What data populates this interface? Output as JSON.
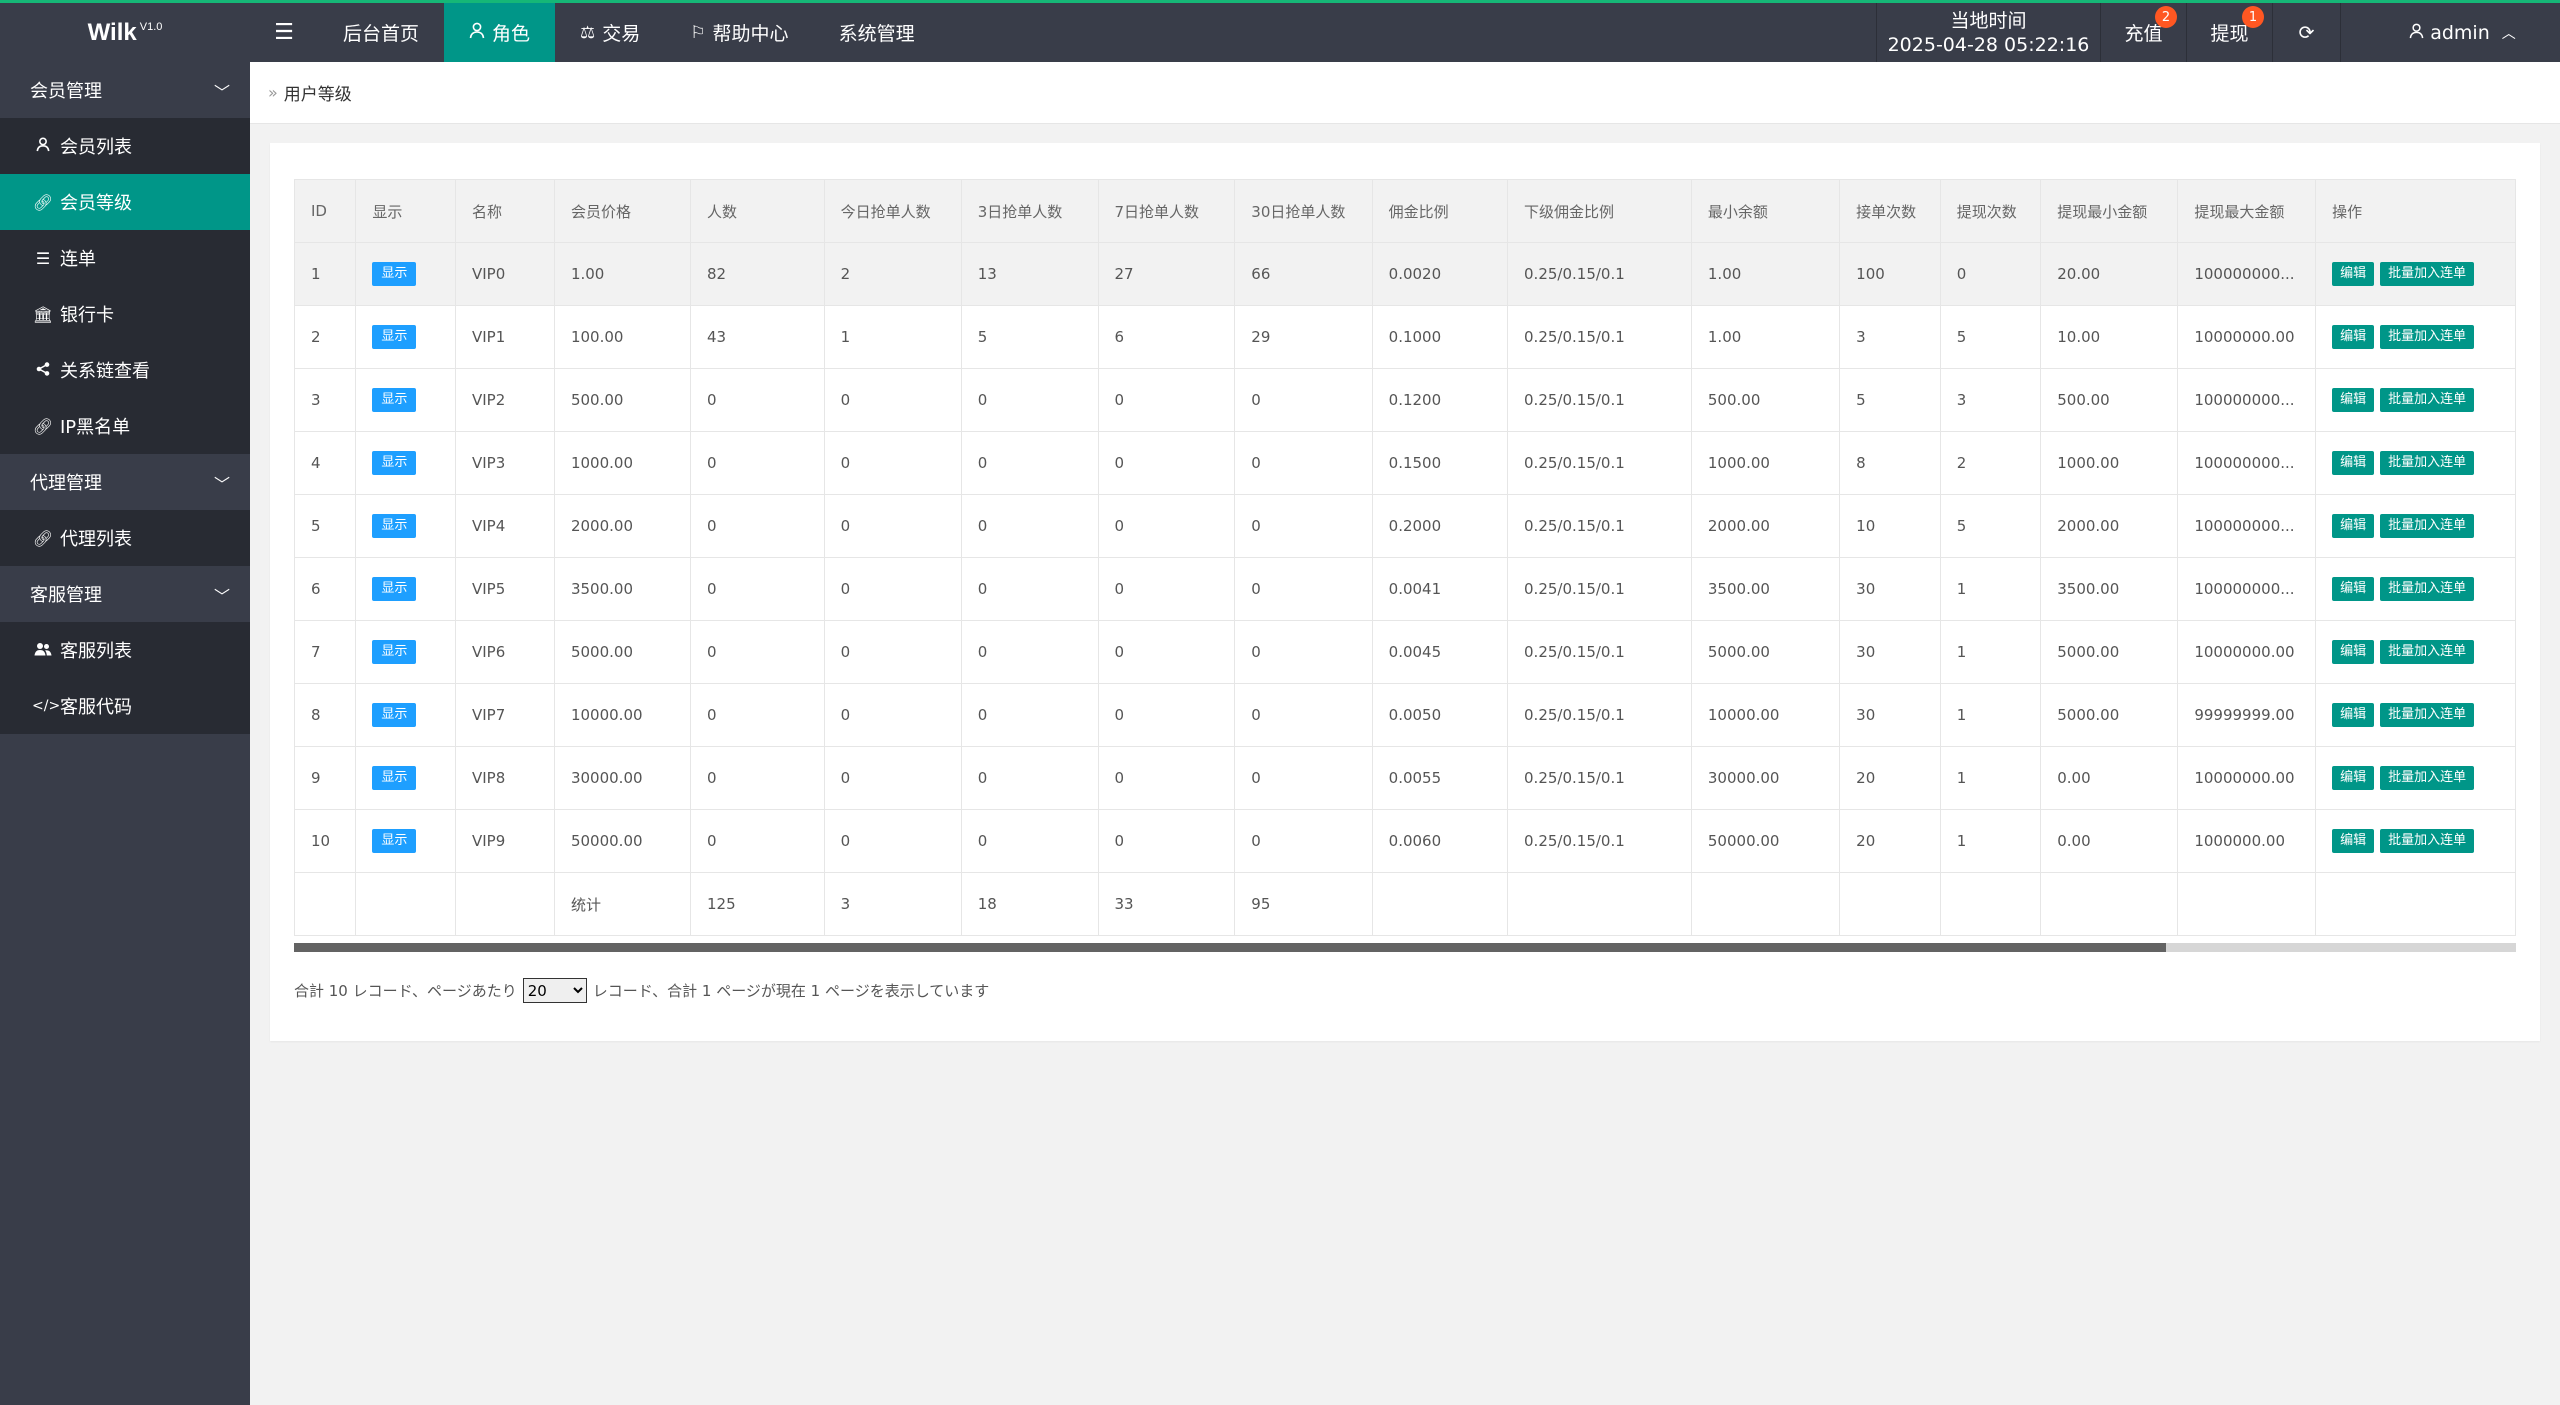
{
  "app": {
    "name": "Wilk",
    "version": "V1.0"
  },
  "topnav": {
    "menu_icon": "hamburger-icon",
    "items": [
      {
        "label": "后台首页",
        "icon": ""
      },
      {
        "label": "角色",
        "icon": "user-icon"
      },
      {
        "label": "交易",
        "icon": "balance-scale-icon"
      },
      {
        "label": "帮助中心",
        "icon": "flag-icon"
      },
      {
        "label": "系统管理",
        "icon": ""
      }
    ],
    "clock_label": "当地时间",
    "clock_value": "2025-04-28 05:22:16",
    "recharge_label": "充值",
    "recharge_badge": "2",
    "withdraw_label": "提现",
    "withdraw_badge": "1",
    "user_label": "admin"
  },
  "sidebar": {
    "groups": [
      {
        "label": "会员管理",
        "items": [
          {
            "label": "会员列表",
            "icon": "user-icon"
          },
          {
            "label": "会员等级",
            "icon": "link-icon"
          },
          {
            "label": "连单",
            "icon": "list-icon"
          },
          {
            "label": "银行卡",
            "icon": "bank-icon"
          },
          {
            "label": "关系链查看",
            "icon": "share-icon"
          },
          {
            "label": "IP黑名单",
            "icon": "link-icon"
          }
        ]
      },
      {
        "label": "代理管理",
        "items": [
          {
            "label": "代理列表",
            "icon": "link-icon"
          }
        ]
      },
      {
        "label": "客服管理",
        "items": [
          {
            "label": "客服列表",
            "icon": "users-icon"
          },
          {
            "label": "客服代码",
            "icon": "code-icon"
          }
        ]
      }
    ]
  },
  "breadcrumb": {
    "current": "用户等级"
  },
  "table": {
    "headers": [
      "ID",
      "显示",
      "名称",
      "会员价格",
      "人数",
      "今日抢单人数",
      "3日抢单人数",
      "7日抢单人数",
      "30日抢单人数",
      "佣金比例",
      "下级佣金比例",
      "最小余额",
      "接单次数",
      "提现次数",
      "提现最小金额",
      "提现最大金额"
    ],
    "ops_header": "操作",
    "show_label": "显示",
    "edit_label": "编辑",
    "batch_label": "批量加入连单",
    "rows": [
      [
        "1",
        "显示",
        "VIP0",
        "1.00",
        "82",
        "2",
        "13",
        "27",
        "66",
        "0.0020",
        "0.25/0.15/0.1",
        "1.00",
        "100",
        "0",
        "20.00",
        "100000000..."
      ],
      [
        "2",
        "显示",
        "VIP1",
        "100.00",
        "43",
        "1",
        "5",
        "6",
        "29",
        "0.1000",
        "0.25/0.15/0.1",
        "1.00",
        "3",
        "5",
        "10.00",
        "10000000.00"
      ],
      [
        "3",
        "显示",
        "VIP2",
        "500.00",
        "0",
        "0",
        "0",
        "0",
        "0",
        "0.1200",
        "0.25/0.15/0.1",
        "500.00",
        "5",
        "3",
        "500.00",
        "100000000..."
      ],
      [
        "4",
        "显示",
        "VIP3",
        "1000.00",
        "0",
        "0",
        "0",
        "0",
        "0",
        "0.1500",
        "0.25/0.15/0.1",
        "1000.00",
        "8",
        "2",
        "1000.00",
        "100000000..."
      ],
      [
        "5",
        "显示",
        "VIP4",
        "2000.00",
        "0",
        "0",
        "0",
        "0",
        "0",
        "0.2000",
        "0.25/0.15/0.1",
        "2000.00",
        "10",
        "5",
        "2000.00",
        "100000000..."
      ],
      [
        "6",
        "显示",
        "VIP5",
        "3500.00",
        "0",
        "0",
        "0",
        "0",
        "0",
        "0.0041",
        "0.25/0.15/0.1",
        "3500.00",
        "30",
        "1",
        "3500.00",
        "100000000..."
      ],
      [
        "7",
        "显示",
        "VIP6",
        "5000.00",
        "0",
        "0",
        "0",
        "0",
        "0",
        "0.0045",
        "0.25/0.15/0.1",
        "5000.00",
        "30",
        "1",
        "5000.00",
        "10000000.00"
      ],
      [
        "8",
        "显示",
        "VIP7",
        "10000.00",
        "0",
        "0",
        "0",
        "0",
        "0",
        "0.0050",
        "0.25/0.15/0.1",
        "10000.00",
        "30",
        "1",
        "5000.00",
        "99999999.00"
      ],
      [
        "9",
        "显示",
        "VIP8",
        "30000.00",
        "0",
        "0",
        "0",
        "0",
        "0",
        "0.0055",
        "0.25/0.15/0.1",
        "30000.00",
        "20",
        "1",
        "0.00",
        "10000000.00"
      ],
      [
        "10",
        "显示",
        "VIP9",
        "50000.00",
        "0",
        "0",
        "0",
        "0",
        "0",
        "0.0060",
        "0.25/0.15/0.1",
        "50000.00",
        "20",
        "1",
        "0.00",
        "1000000.00"
      ]
    ],
    "total_row": [
      "",
      "",
      "",
      "统计",
      "125",
      "3",
      "18",
      "33",
      "95",
      "",
      "",
      "",
      "",
      "",
      "",
      ""
    ]
  },
  "pager": {
    "prefix": "合計 10 レコード、ページあたり",
    "page_size": "20",
    "suffix": "レコード、合計 1 ページが現在 1 ページを表示しています"
  },
  "colors": {
    "topbar": "#393D49",
    "accent": "#009688",
    "accent_line": "#16b777",
    "show_btn": "#1E9FFF",
    "badge": "#ff5722"
  }
}
